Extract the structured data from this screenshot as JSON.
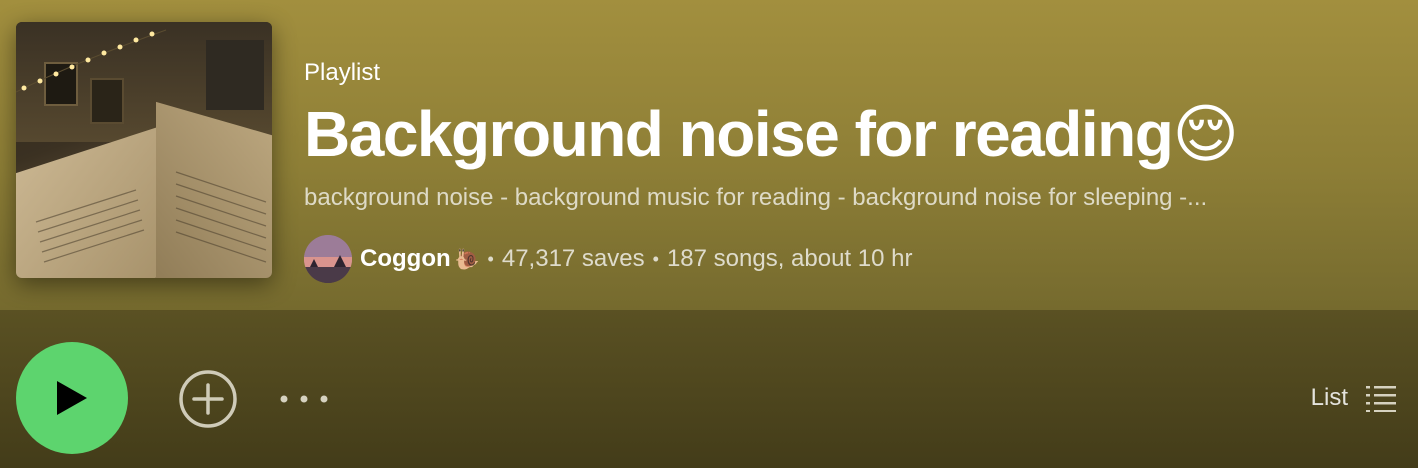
{
  "playlist": {
    "type_label": "Playlist",
    "title": "Background noise for reading",
    "title_emoji": "😌",
    "description": "background noise - background music for reading - background noise for sleeping -...",
    "owner": "Coggon",
    "owner_emoji": "🐌",
    "saves": "47,317 saves",
    "summary": "187 songs, about 10 hr",
    "separator": "•"
  },
  "actions": {
    "view_label": "List"
  },
  "icons": {
    "play": "play-icon",
    "add": "add-circle-icon",
    "more": "more-options-icon",
    "list": "list-view-icon"
  },
  "colors": {
    "accent": "#5dd46e",
    "header_bg": "#9a893b",
    "actions_bg": "#4a4420"
  }
}
